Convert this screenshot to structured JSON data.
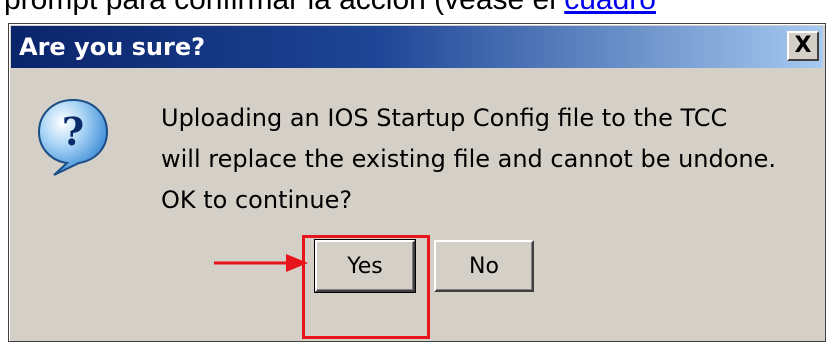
{
  "document": {
    "partial_text": "prompt para confirmar la acción (véase el ",
    "link_text": "cuadro"
  },
  "dialog": {
    "title": "Are you sure?",
    "close_label": "X",
    "icon": "question-icon",
    "message_lines": [
      "Uploading an IOS Startup Config file to the TCC",
      "will replace the existing file and cannot be undone.",
      "OK to continue?"
    ],
    "buttons": {
      "yes_label": "Yes",
      "no_label": "No"
    }
  },
  "annotation": {
    "highlight_color": "#e8141b",
    "arrow": "arrow-right-icon",
    "highlighted_button": "Yes"
  }
}
